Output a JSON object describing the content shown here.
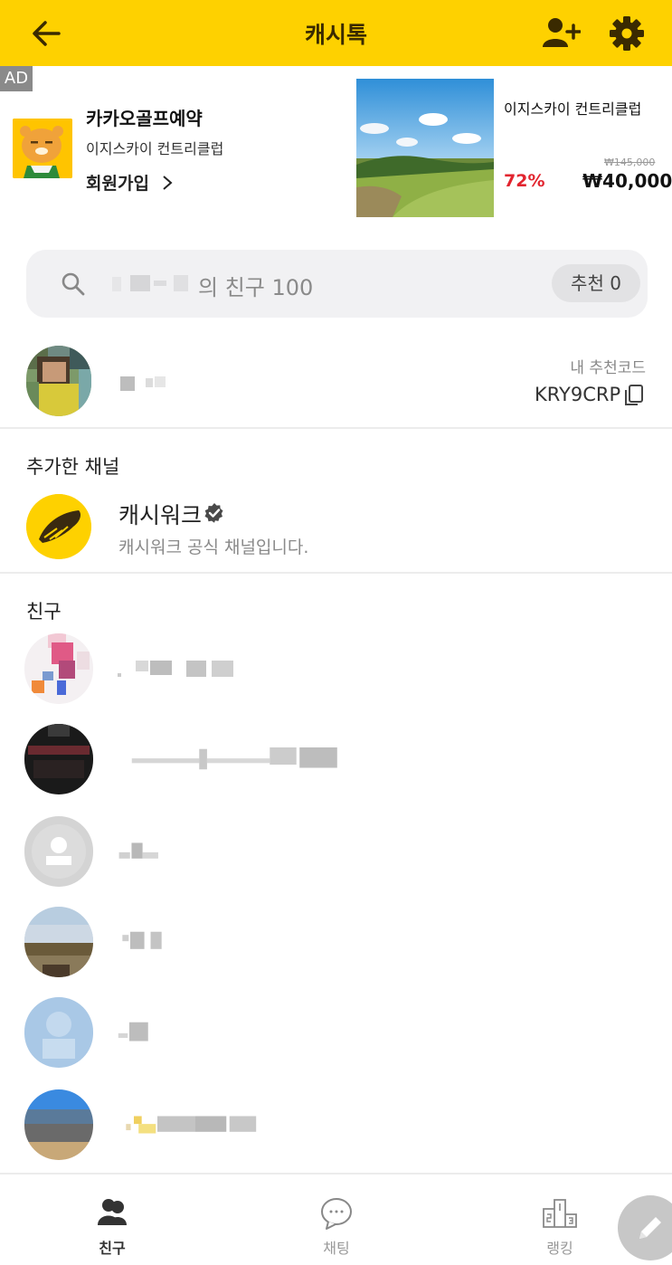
{
  "header": {
    "title": "캐시톡",
    "back_icon": "arrow-left-icon",
    "add_friend_icon": "add-friend-icon",
    "settings_icon": "gear-icon",
    "background": "#fed100"
  },
  "ad": {
    "badge": "AD",
    "brand": "카카오골프예약",
    "subtitle": "이지스카이 컨트리클럽",
    "cta": "회원가입",
    "product_title": "이지스카이 컨트리클럽",
    "original_price": "₩145,000",
    "discount": "72%",
    "price": "₩40,000",
    "discount_color": "#e2252f"
  },
  "search": {
    "label": "의 친구 100",
    "recommend": "추천 0",
    "icon": "search-icon"
  },
  "profile": {
    "code_label": "내 추천코드",
    "code": "KRY9CRP",
    "copy_icon": "copy-icon"
  },
  "channels": {
    "title": "추가한 채널",
    "items": [
      {
        "name": "캐시워크",
        "desc": "캐시워크 공식 채널입니다.",
        "verified_icon": "verified-badge-icon"
      }
    ]
  },
  "friends": {
    "title": "친구"
  },
  "nav": {
    "tabs": [
      {
        "label": "친구",
        "icon": "friends-icon",
        "active": true
      },
      {
        "label": "채팅",
        "icon": "chat-bubble-icon",
        "active": false
      },
      {
        "label": "랭킹",
        "icon": "podium-icon",
        "active": false
      }
    ],
    "fab_icon": "pencil-icon"
  }
}
